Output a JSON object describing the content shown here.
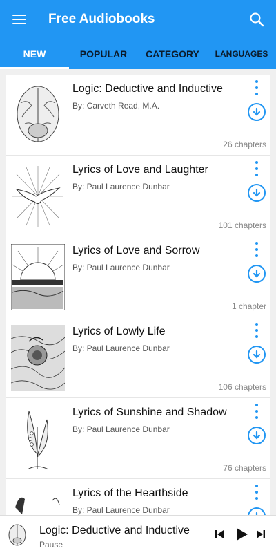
{
  "app": {
    "title": "Free Audiobooks"
  },
  "icons": {
    "menu": "menu-icon",
    "search": "search-icon",
    "more": "more-vert-icon",
    "download": "download-icon",
    "prev": "skip-previous-icon",
    "play": "play-icon",
    "next": "skip-next-icon"
  },
  "colors": {
    "primary": "#2196F3",
    "tab_inactive": "#0b1b2b"
  },
  "tabs": [
    {
      "label": "NEW"
    },
    {
      "label": "POPULAR"
    },
    {
      "label": "CATEGORY"
    },
    {
      "label": "LANGUAGES"
    }
  ],
  "active_tab": "NEW",
  "books": [
    {
      "title": "Logic: Deductive and Inductive",
      "author": "By: Carveth Read, M.A.",
      "chapters": "26 chapters"
    },
    {
      "title": "Lyrics of Love and Laughter",
      "author": "By: Paul Laurence Dunbar",
      "chapters": "101 chapters"
    },
    {
      "title": "Lyrics of Love and Sorrow",
      "author": "By: Paul Laurence Dunbar",
      "chapters": "1 chapter"
    },
    {
      "title": "Lyrics of Lowly Life",
      "author": "By: Paul Laurence Dunbar",
      "chapters": "106 chapters"
    },
    {
      "title": "Lyrics of Sunshine and Shadow",
      "author": "By: Paul Laurence Dunbar",
      "chapters": "76 chapters"
    },
    {
      "title": "Lyrics of the Hearthside",
      "author": "By: Paul Laurence Dunbar",
      "chapters": ""
    }
  ],
  "player": {
    "title": "Logic: Deductive and Inductive",
    "status": "Pause"
  }
}
